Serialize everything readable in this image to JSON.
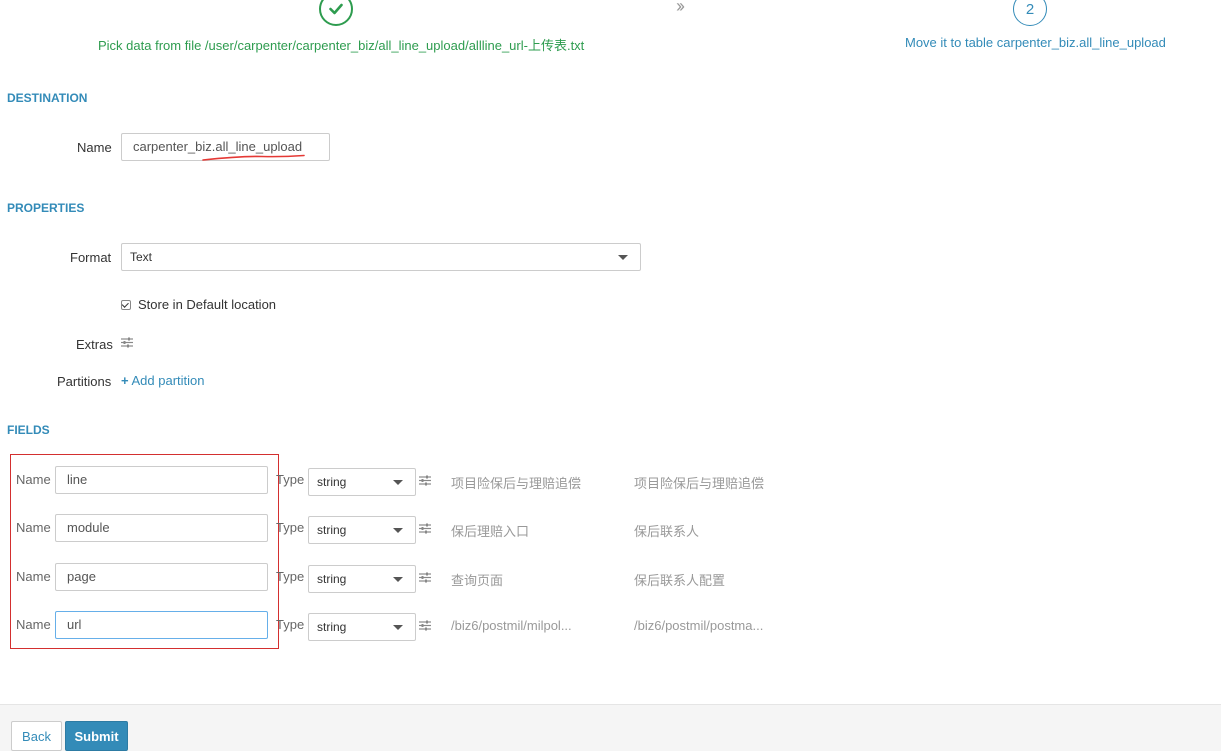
{
  "wizard": {
    "step1_label": "Pick data from file /user/carpenter/carpenter_biz/all_line_upload/allline_url-上传表.txt",
    "step2_number": "2",
    "step2_label": "Move it to table carpenter_biz.all_line_upload"
  },
  "destination": {
    "title": "DESTINATION",
    "name_label": "Name",
    "name_value": "carpenter_biz.all_line_upload"
  },
  "properties": {
    "title": "PROPERTIES",
    "format_label": "Format",
    "format_value": "Text",
    "store_default_label": "Store in Default location",
    "store_default_checked": true,
    "extras_label": "Extras",
    "partitions_label": "Partitions",
    "add_partition_label": "Add partition"
  },
  "fields": {
    "title": "FIELDS",
    "name_label": "Name",
    "type_label": "Type",
    "rows": [
      {
        "name": "line",
        "type": "string",
        "sample1": "项目险保后与理赔追偿",
        "sample2": "项目险保后与理赔追偿"
      },
      {
        "name": "module",
        "type": "string",
        "sample1": "保后理赔入口",
        "sample2": "保后联系人"
      },
      {
        "name": "page",
        "type": "string",
        "sample1": "查询页面",
        "sample2": "保后联系人配置"
      },
      {
        "name": "url",
        "type": "string",
        "sample1": "/biz6/postmil/milpol...",
        "sample2": "/biz6/postmil/postma..."
      }
    ]
  },
  "footer": {
    "back_label": "Back",
    "submit_label": "Submit"
  },
  "colors": {
    "accent": "#338bb8",
    "success": "#2e9c4f",
    "highlight": "#d32f2f"
  }
}
